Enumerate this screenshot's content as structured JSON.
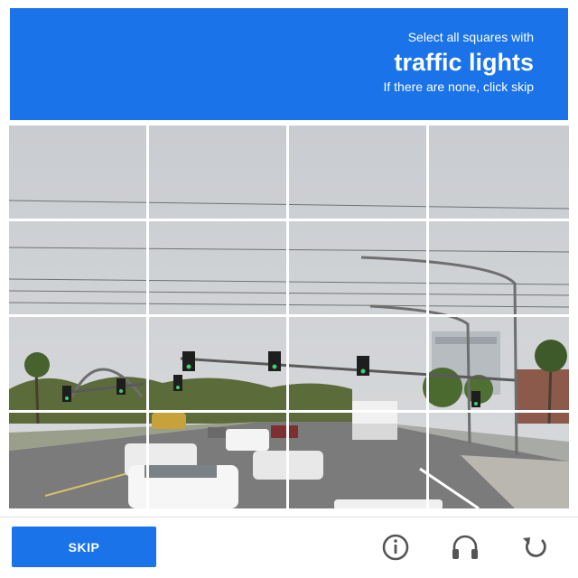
{
  "header": {
    "line1": "Select all squares with",
    "line2": "traffic lights",
    "line3": "If there are none, click skip"
  },
  "grid": {
    "rows": 4,
    "cols": 4,
    "image_description_alt": "street"
  },
  "footer": {
    "skip_label": "SKIP",
    "icons": [
      "info-icon",
      "headphones-icon",
      "reload-icon"
    ]
  },
  "colors": {
    "accent": "#1a73e8",
    "icon": "#555555"
  }
}
